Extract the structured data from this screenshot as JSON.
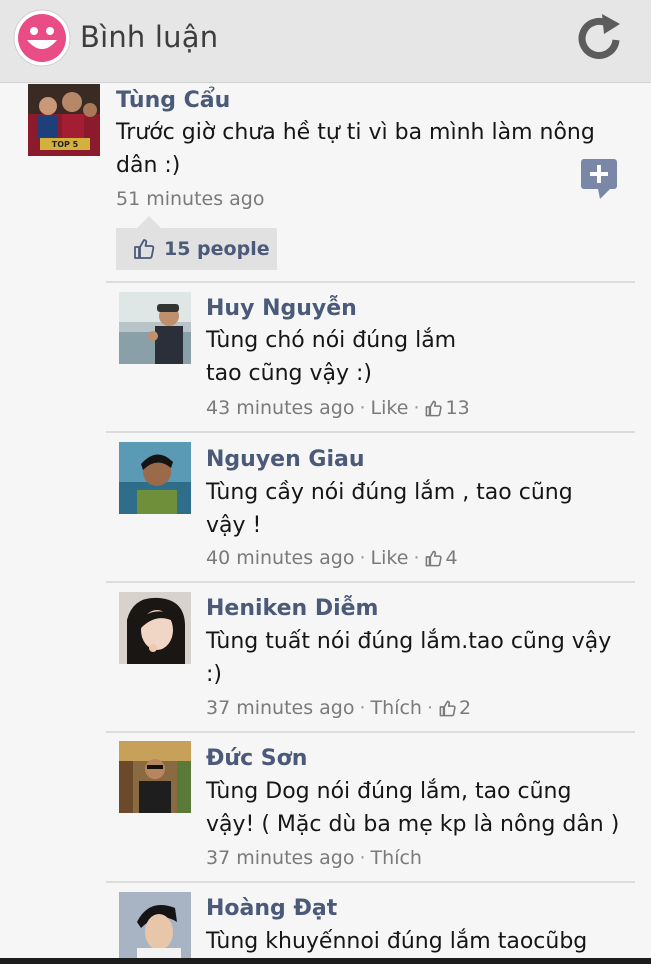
{
  "header": {
    "title": "Bình luận",
    "app_icon": "smiley-icon",
    "refresh_icon": "refresh-icon"
  },
  "post": {
    "author": "Tùng Cẩu",
    "text": "Trước giờ chưa hề tự ti vì ba mình làm nông\ndân :)",
    "time": "51 minutes ago",
    "likes": "15 people",
    "add_icon": "add-comment-icon"
  },
  "replies": [
    {
      "author": "Huy Nguyễn",
      "text": "Tùng chó nói đúng lắm\ntao cũng vậy :)",
      "time": "43 minutes ago",
      "action": "Like",
      "likes": "13"
    },
    {
      "author": "Nguyen Giau",
      "text": "Tùng cầy nói đúng lắm , tao cũng\nvậy !",
      "time": "40 minutes ago",
      "action": "Like",
      "likes": "4"
    },
    {
      "author": "Heniken Diễm",
      "text": "Tùng tuất nói đúng lắm.tao cũng vậy\n:)",
      "time": "37 minutes ago",
      "action": "Thích",
      "likes": "2"
    },
    {
      "author": "Đức Sơn",
      "text": "Tùng Dog nói đúng lắm, tao cũng\nvậy! ( Mặc dù ba mẹ kp là nông dân )",
      "time": "37 minutes ago",
      "action": "Thích",
      "likes": ""
    },
    {
      "author": "Hoàng Đạt",
      "text": "Tùng khuyếnnoi đúng lắm taocũbg",
      "time": "",
      "action": "",
      "likes": ""
    }
  ],
  "colors": {
    "name": "#4b5a78",
    "header_bg": "#e6e6e6",
    "accent_pink": "#e8407a"
  }
}
